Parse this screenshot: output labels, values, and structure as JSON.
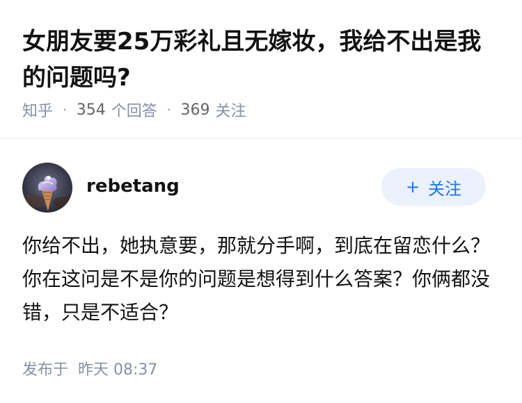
{
  "question": {
    "title": "女朋友要25万彩礼且无嫁妆，我给不出是我的问题吗?",
    "source": "知乎",
    "separator": "·",
    "answer_count": "354",
    "answer_label": "个回答",
    "follower_count": "369",
    "follower_label": "关注"
  },
  "answer": {
    "author": {
      "name": "rebetang",
      "avatar_icon": "avatar-photo-icon"
    },
    "follow_button": {
      "plus": "+",
      "label": "关注"
    },
    "content": "你给不出，她执意要，那就分手啊，到底在留恋什么？你在这问是不是你的问题是想得到什么答案？你俩都没错，只是不适合？",
    "published_label": "发布于",
    "published_time": "昨天 08:37"
  },
  "colors": {
    "text_primary": "#121212",
    "text_secondary": "#8590a6",
    "accent": "#1772f6",
    "follow_bg": "#ebf2fc",
    "divider": "#ebebeb"
  }
}
